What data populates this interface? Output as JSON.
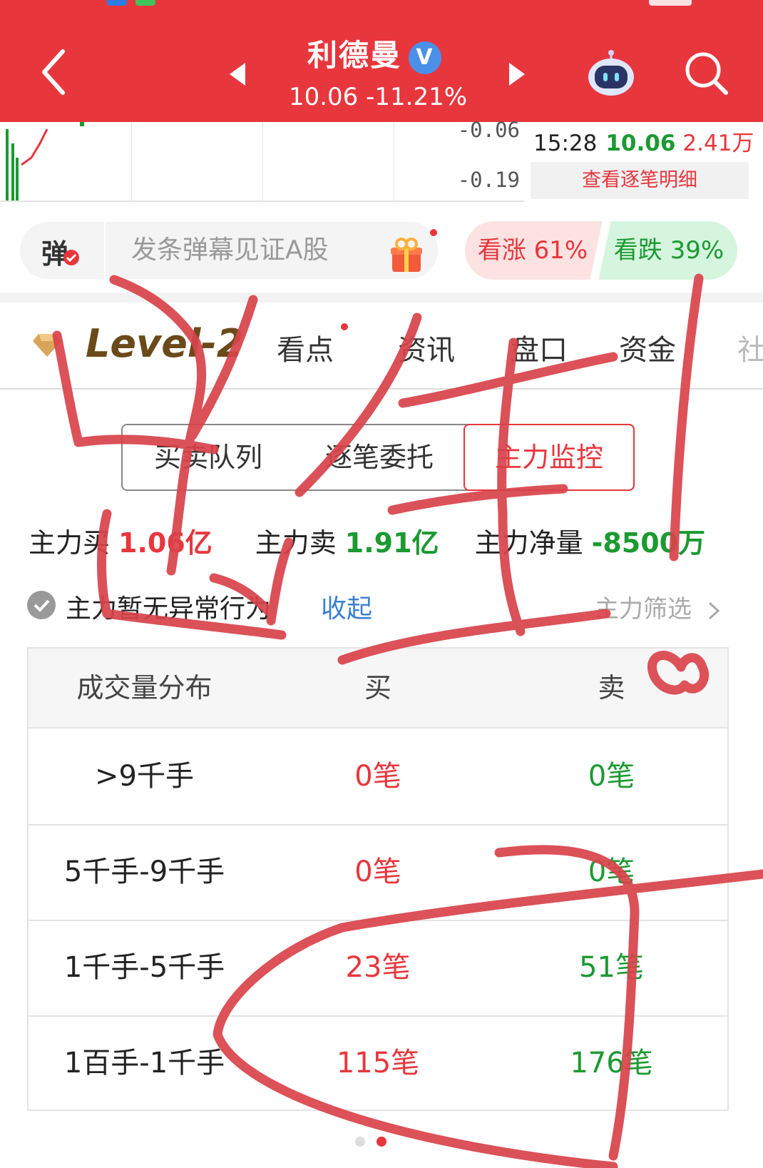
{
  "header": {
    "stock_name": "利德曼",
    "verified_badge": "V",
    "price_line": "10.06 -11.21%",
    "icons": [
      "back-arrow-icon",
      "prev-triangle-icon",
      "next-triangle-icon",
      "robot-assistant-icon",
      "search-icon"
    ]
  },
  "chart": {
    "axis_labels": [
      "-0.06",
      "-0.19"
    ],
    "colors": {
      "up": "#e8363d",
      "down": "#1b9a31"
    }
  },
  "tick": {
    "time": "15:28",
    "price": "10.06",
    "volume": "2.41万",
    "detail_label": "查看逐笔明细"
  },
  "danmu": {
    "button_label": "弹",
    "placeholder": "发条弹幕见证A股",
    "gift_icon": "gift-icon"
  },
  "sentiment": {
    "bull_label": "看涨 61%",
    "bear_label": "看跌 39%",
    "bull_percent": 61,
    "bear_percent": 39
  },
  "tabs": {
    "level2_label": "Level-2",
    "items": [
      "看点",
      "资讯",
      "盘口",
      "资金",
      "社"
    ]
  },
  "segments": {
    "items": [
      "买卖队列",
      "逐笔委托",
      "主力监控"
    ],
    "active_index": 2
  },
  "main_force": {
    "buy_label": "主力买",
    "buy_value": "1.06亿",
    "sell_label": "主力卖",
    "sell_value": "1.91亿",
    "net_label": "主力净量",
    "net_value": "-8500万"
  },
  "notice": {
    "text": "主力暂无异常行为",
    "collapse_label": "收起",
    "filter_label": "主力筛选"
  },
  "distribution": {
    "headers": [
      "成交量分布",
      "买",
      "卖"
    ],
    "rows": [
      {
        "range": ">9千手",
        "buy": "0笔",
        "sell": "0笔"
      },
      {
        "range": "5千手-9千手",
        "buy": "0笔",
        "sell": "0笔"
      },
      {
        "range": "1千手-5千手",
        "buy": "23笔",
        "sell": "51笔"
      },
      {
        "range": "1百手-1千手",
        "buy": "115笔",
        "sell": "176笔"
      }
    ]
  },
  "colors": {
    "brand_red": "#e8363d",
    "down_green": "#1b9a31",
    "link_blue": "#3a7fd5",
    "scribble": "#d9434a"
  }
}
